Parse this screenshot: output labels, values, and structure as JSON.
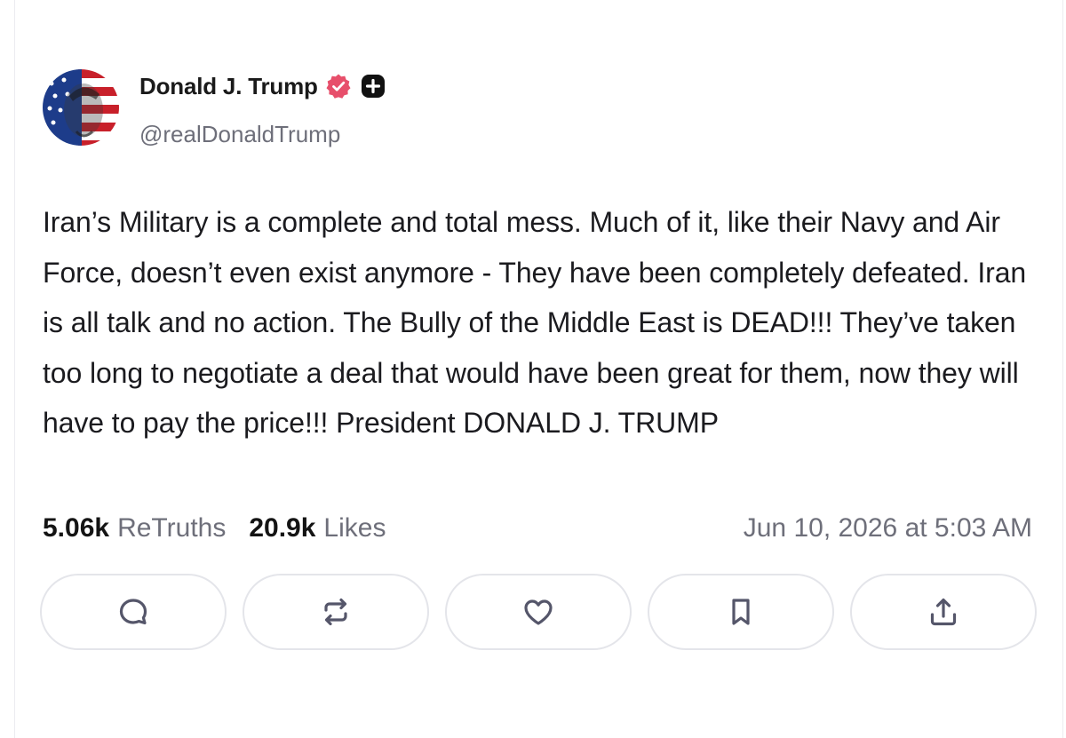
{
  "author": {
    "display_name": "Donald J. Trump",
    "handle": "@realDonaldTrump",
    "verified_icon": "verified-badge-icon",
    "plus_icon": "plus-badge-icon",
    "badge_color": "#e74f6b"
  },
  "post": {
    "text": "Iran’s Military is a complete and total mess. Much of it, like their Navy and Air Force, doesn’t even exist anymore - They have been completely defeated. Iran is all talk and no action. The Bully of the Middle East is DEAD!!! They’ve taken too long to negotiate a deal that would have been great for them, now they will have to pay the price!!! President DONALD J. TRUMP"
  },
  "stats": {
    "retruths_count": "5.06k",
    "retruths_label": "ReTruths",
    "likes_count": "20.9k",
    "likes_label": "Likes",
    "timestamp": "Jun 10, 2026 at 5:03 AM"
  },
  "actions": [
    "reply-icon",
    "retruth-icon",
    "like-icon",
    "bookmark-icon",
    "share-icon"
  ],
  "colors": {
    "text_primary": "#1b1b1f",
    "text_secondary": "#6e6f7a",
    "button_border": "#e4e5ea",
    "icon_color": "#55566a"
  }
}
